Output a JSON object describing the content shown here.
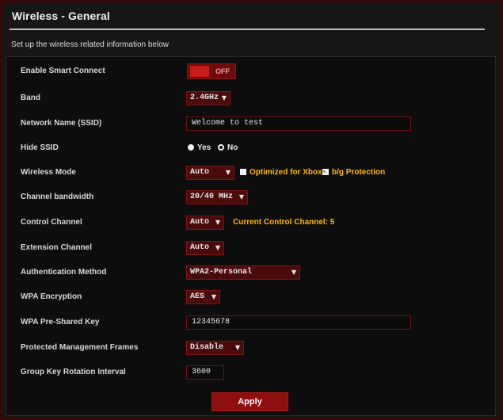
{
  "page": {
    "title": "Wireless - General",
    "subtitle": "Set up the wireless related information below"
  },
  "settings": {
    "smart_connect": {
      "label": "Enable Smart Connect",
      "state_text": "OFF"
    },
    "band": {
      "label": "Band",
      "value": "2.4GHz"
    },
    "ssid": {
      "label": "Network Name (SSID)",
      "value": "Welcome to test"
    },
    "hide_ssid": {
      "label": "Hide SSID",
      "yes": "Yes",
      "no": "No",
      "selected": "No"
    },
    "wireless_mode": {
      "label": "Wireless Mode",
      "value": "Auto",
      "xbox_option": "Optimized for Xbox",
      "bg_option": "b/g Protection"
    },
    "channel_bandwidth": {
      "label": "Channel bandwidth",
      "value": "20/40 MHz"
    },
    "control_channel": {
      "label": "Control Channel",
      "value": "Auto",
      "current_text": "Current Control Channel: 5"
    },
    "extension_channel": {
      "label": "Extension Channel",
      "value": "Auto"
    },
    "auth_method": {
      "label": "Authentication Method",
      "value": "WPA2-Personal"
    },
    "wpa_encryption": {
      "label": "WPA Encryption",
      "value": "AES"
    },
    "psk": {
      "label": "WPA Pre-Shared Key",
      "value": "12345678"
    },
    "pmf": {
      "label": "Protected Management Frames",
      "value": "Disable"
    },
    "group_key": {
      "label": "Group Key Rotation Interval",
      "value": "3600"
    }
  },
  "actions": {
    "apply_label": "Apply"
  },
  "colors": {
    "accent": "#ffb800",
    "control_bg": "#4a0b0b",
    "button_bg": "#8f0e0e"
  },
  "icons": {
    "dropdown": "triangle-down-icon",
    "radio": "radio-icon",
    "checkbox": "checkbox-icon"
  }
}
